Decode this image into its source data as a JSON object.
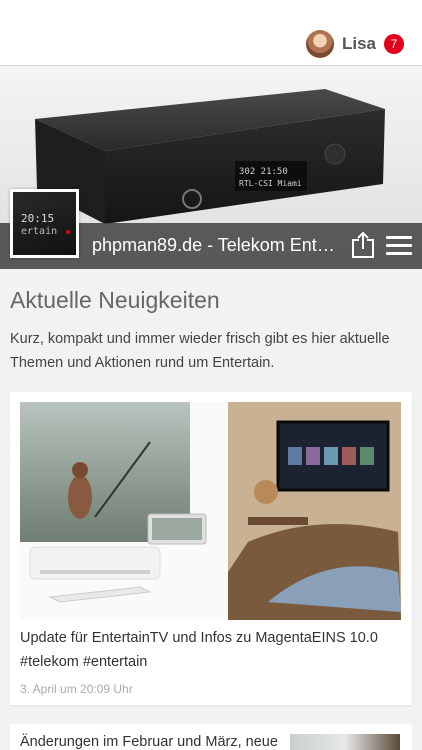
{
  "user": {
    "name": "Lisa",
    "notifications": "7"
  },
  "hero": {
    "title": "phpman89.de - Telekom Entertain",
    "device_display_line1": "302  21:50",
    "device_display_line2": "RTL-CSI Miami",
    "thumb_line1": "20:15",
    "thumb_line2": "ertain"
  },
  "icons": {
    "share": "share-icon",
    "menu": "hamburger-menu-icon"
  },
  "section": {
    "title": "Aktuelle Neuigkeiten",
    "description": "Kurz, kompakt und immer wieder frisch gibt es hier aktuelle Themen und Aktionen rund um Entertain."
  },
  "posts": [
    {
      "title": "Update für EntertainTV und Infos zu MagentaEINS 10.0 #telekom #entertain",
      "date": "3. April um 20:09 Uhr"
    },
    {
      "title": "Änderungen im Februar und März, neue"
    }
  ],
  "colors": {
    "accent": "#e2001a",
    "title_bar": "#464646"
  }
}
